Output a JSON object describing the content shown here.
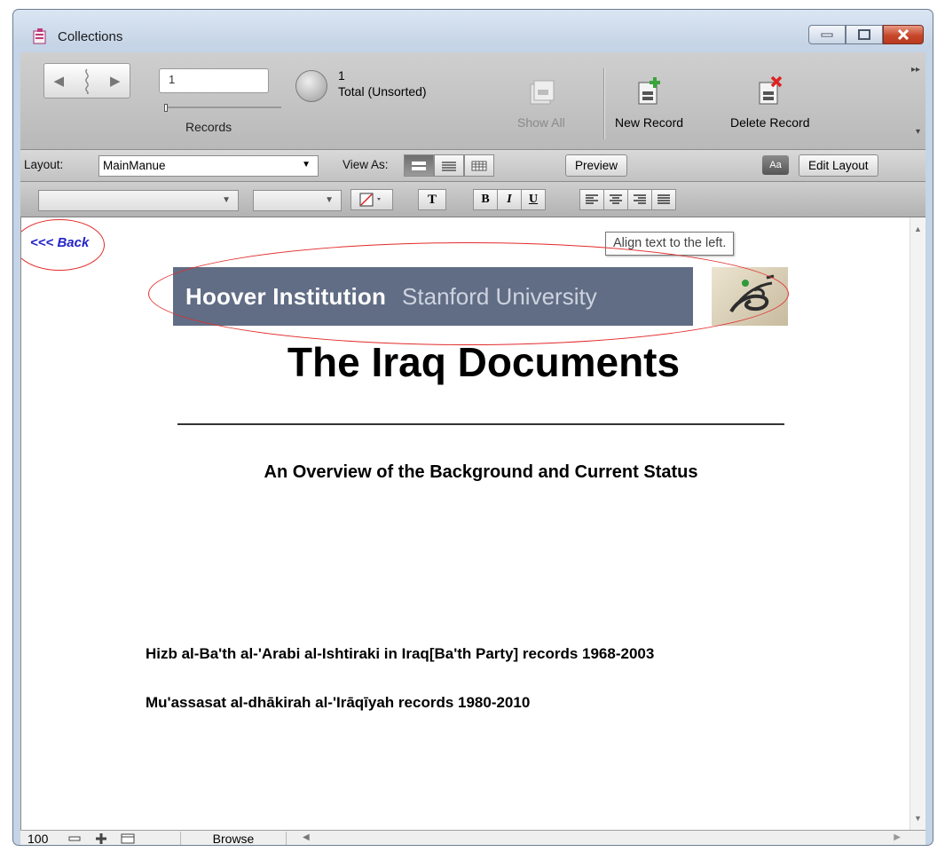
{
  "window": {
    "title": "Collections"
  },
  "toolbar": {
    "record_value": "1",
    "records_label": "Records",
    "found_count": "1",
    "total_label": "Total (Unsorted)",
    "show_all_label": "Show All",
    "new_record_label": "New Record",
    "delete_record_label": "Delete Record"
  },
  "layout_bar": {
    "layout_label": "Layout:",
    "layout_value": "MainManue",
    "view_as_label": "View As:",
    "preview_label": "Preview",
    "aa_label": "Aa",
    "edit_layout_label": "Edit Layout"
  },
  "format_bar": {
    "bold": "B",
    "italic": "I",
    "underline": "U",
    "text": "T"
  },
  "content": {
    "back_link": "<<< Back",
    "tooltip": "Align text to the left.",
    "banner_primary": "Hoover Institution",
    "banner_secondary": "Stanford University",
    "title": "The Iraq Documents",
    "subtitle": "An Overview of the Background and Current Status",
    "collections": [
      "Hizb al-Ba'th al-'Arabi al-Ishtiraki in Iraq[Ba'th Party] records 1968-2003",
      "Mu'assasat al-dhākirah al-'Irāqīyah records 1980-2010"
    ]
  },
  "status_bar": {
    "zoom": "100",
    "mode": "Browse"
  },
  "colors": {
    "banner": "#616d85",
    "back_link": "#2323c9",
    "annotation": "#e32b2b",
    "close_button": "#c7472b"
  }
}
